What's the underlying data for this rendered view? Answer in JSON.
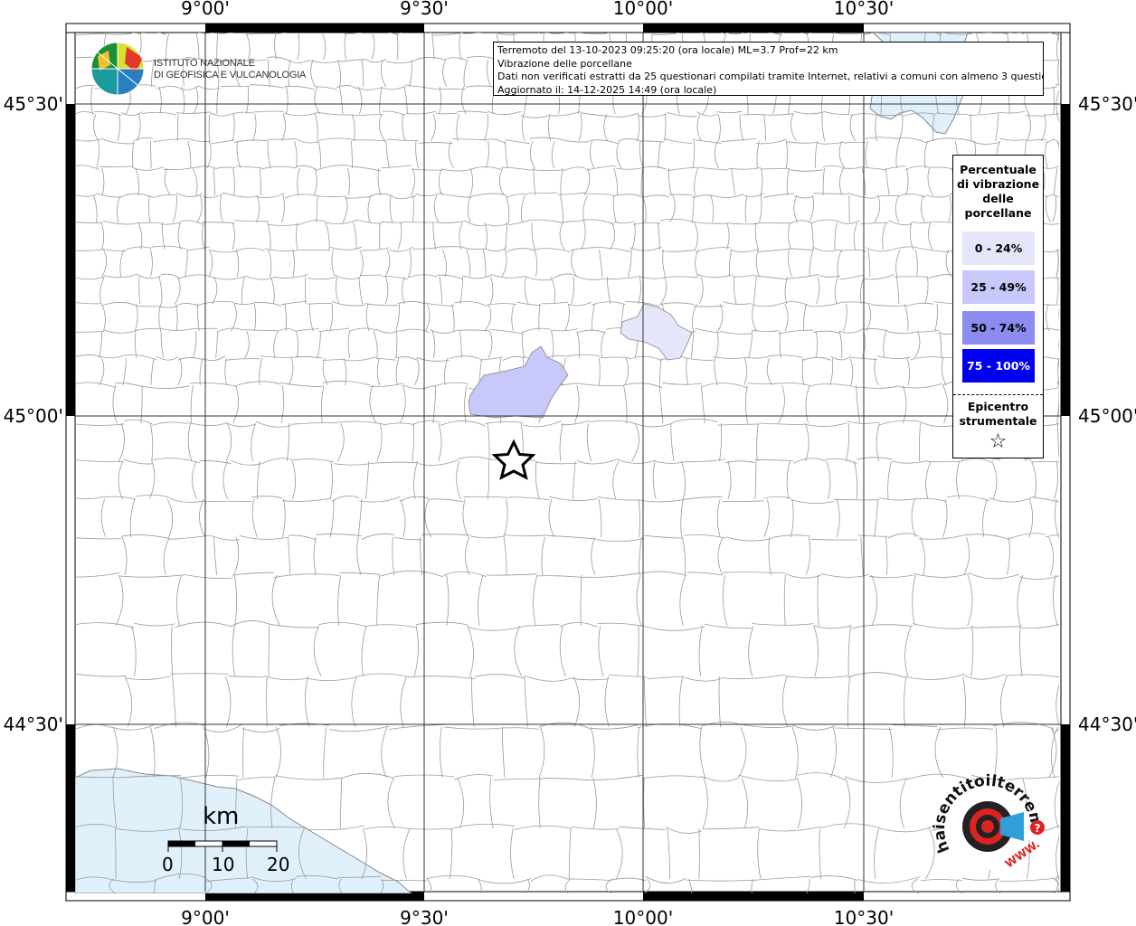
{
  "info": {
    "line1": "Terremoto del 13-10-2023 09:25:20 (ora locale) ML=3.7 Prof=22 km",
    "line2": "Vibrazione delle porcellane",
    "line3": "Dati non verificati estratti da 25 questionari compilati tramite Internet, relativi a comuni con almeno 3 questionari.",
    "line4": "Aggiornato il: 14-12-2025 14:49 (ora locale)"
  },
  "axes": {
    "lon_labels": [
      "9°00'",
      "9°30'",
      "10°00'",
      "10°30'"
    ],
    "lat_labels": [
      "45°30'",
      "45°00'",
      "44°30'"
    ]
  },
  "logo": {
    "line1": "ISTITUTO NAZIONALE",
    "line2": "DI GEOFISICA E VULCANOLOGIA",
    "badge_text": "haisentitoilterremoto.it",
    "badge_url": "WWW.",
    "badge_q": "?"
  },
  "legend": {
    "title": "Percentuale di vibrazione delle porcellane",
    "items": [
      {
        "label": "0 - 24%",
        "color": "#e6e6fa",
        "text_color": "#000000"
      },
      {
        "label": "25 - 49%",
        "color": "#c8c8fa",
        "text_color": "#000000"
      },
      {
        "label": "50 - 74%",
        "color": "#8c8cf0",
        "text_color": "#000000"
      },
      {
        "label": "75 - 100%",
        "color": "#0000f0",
        "text_color": "#ffffff"
      }
    ],
    "epicenter_label": "Epicentro strumentale",
    "epicenter_symbol": "☆"
  },
  "scale": {
    "unit": "km",
    "labels": [
      "0",
      "10",
      "20"
    ]
  },
  "colors": {
    "sea": "#dff0fb",
    "border": "#999999",
    "grid": "#333333"
  }
}
